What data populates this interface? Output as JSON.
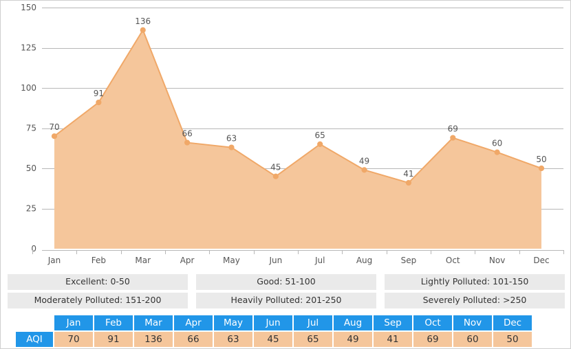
{
  "chart_data": {
    "type": "area",
    "title": "",
    "subtitle": "",
    "xlabel": "",
    "ylabel": "",
    "categories": [
      "Jan",
      "Feb",
      "Mar",
      "Apr",
      "May",
      "Jun",
      "Jul",
      "Aug",
      "Sep",
      "Oct",
      "Nov",
      "Dec"
    ],
    "series": [
      {
        "name": "AQI",
        "values": [
          70,
          91,
          136,
          66,
          63,
          45,
          65,
          49,
          41,
          69,
          60,
          50
        ]
      }
    ],
    "ylim": [
      0,
      150
    ],
    "yticks": [
      0,
      25,
      50,
      75,
      100,
      125,
      150
    ],
    "ytick_labels": [
      "0",
      "25",
      "50",
      "75",
      "100",
      "125",
      "150"
    ],
    "grid": true,
    "legend_position": "below-chart",
    "data_labels": true,
    "colors": {
      "line": "#f0a868",
      "fill": "#f5c69b",
      "marker": "#f0a868",
      "grid": "#b7b7b7",
      "axis_text": "#555555",
      "table_header": "#2196e8",
      "table_value": "#f5c69b"
    }
  },
  "legend": {
    "rows": [
      [
        {
          "label": "Excellent: 0-50"
        },
        {
          "label": "Good: 51-100"
        },
        {
          "label": "Lightly Polluted: 101-150"
        }
      ],
      [
        {
          "label": "Moderately Polluted: 151-200"
        },
        {
          "label": "Heavily Polluted: 201-250"
        },
        {
          "label": "Severely Polluted: >250"
        }
      ]
    ]
  },
  "table": {
    "row_label": "AQI",
    "headers": [
      "Jan",
      "Feb",
      "Mar",
      "Apr",
      "May",
      "Jun",
      "Jul",
      "Aug",
      "Sep",
      "Oct",
      "Nov",
      "Dec"
    ],
    "values": [
      "70",
      "91",
      "136",
      "66",
      "63",
      "45",
      "65",
      "49",
      "41",
      "69",
      "60",
      "50"
    ]
  }
}
